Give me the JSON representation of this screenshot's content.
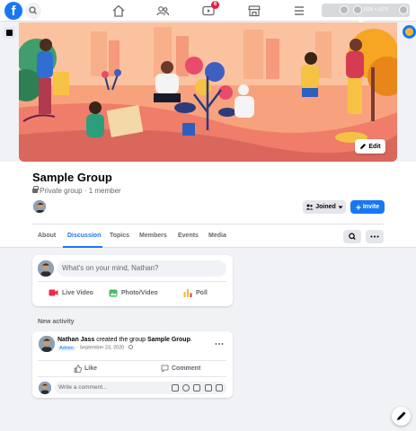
{
  "nav": {
    "notification_count": "6",
    "extension_label": "1025 × 1073"
  },
  "cover": {
    "edit_label": "Edit"
  },
  "group": {
    "name": "Sample Group",
    "privacy": "Private group",
    "separator": " · ",
    "members": "1 member",
    "joined_label": "Joined",
    "invite_label": "Invite"
  },
  "tabs": [
    {
      "label": "About"
    },
    {
      "label": "Discussion"
    },
    {
      "label": "Topics"
    },
    {
      "label": "Members"
    },
    {
      "label": "Events"
    },
    {
      "label": "Media"
    }
  ],
  "composer": {
    "placeholder": "What's on your mind, Nathan?",
    "actions": [
      {
        "label": "Live Video",
        "color": "#f02849"
      },
      {
        "label": "Photo/Video",
        "color": "#45bd62"
      },
      {
        "label": "Poll",
        "color": "#f7b928"
      }
    ]
  },
  "activity": {
    "heading": "New activity"
  },
  "post": {
    "author": "Nathan Jass",
    "action_text": " created the group ",
    "group_name": "Sample Group",
    "period": ".",
    "role": "Admin",
    "date": " · September 23, 2020 · ",
    "like_label": "Like",
    "comment_label": "Comment",
    "comment_placeholder": "Write a comment..."
  },
  "colors": {
    "brand": "#1877f2",
    "badge": "#e41e3f"
  }
}
